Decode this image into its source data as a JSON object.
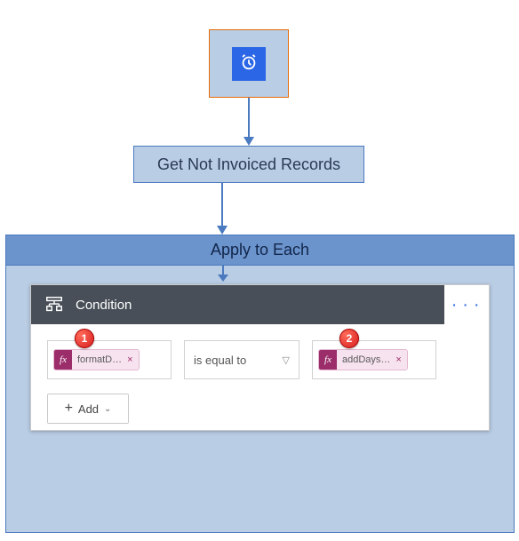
{
  "trigger": {
    "icon": "alarm-clock-icon"
  },
  "step_get": {
    "label": "Get Not Invoiced Records"
  },
  "loop": {
    "title": "Apply to Each"
  },
  "condition": {
    "title": "Condition",
    "menu_label": "· · ·",
    "left_token": {
      "fx": "fx",
      "label": "formatD…",
      "remove": "×",
      "badge": "1"
    },
    "operator": {
      "label": "is equal to"
    },
    "right_token": {
      "fx": "fx",
      "label": "addDays…",
      "remove": "×",
      "badge": "2"
    },
    "add_button": {
      "plus": "+",
      "label": "Add"
    }
  }
}
